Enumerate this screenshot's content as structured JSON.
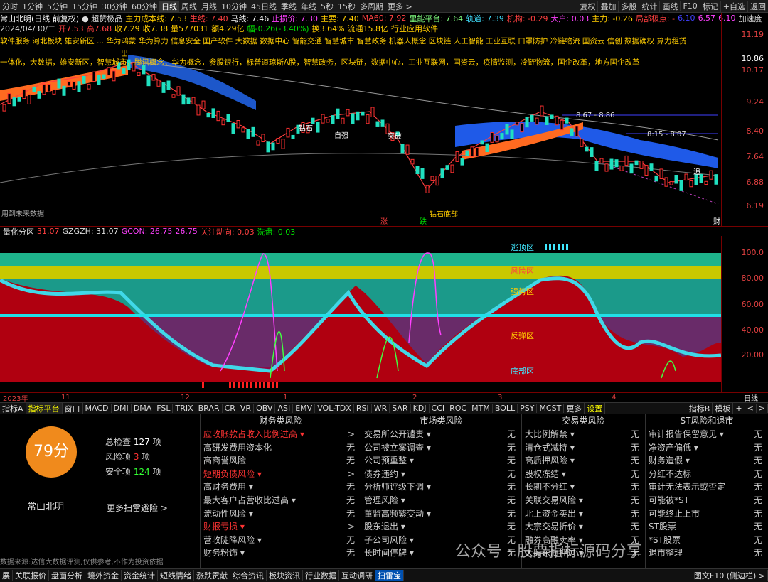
{
  "topbar": {
    "periods": [
      "分时",
      "1分钟",
      "5分钟",
      "15分钟",
      "30分钟",
      "60分钟",
      "日线",
      "周线",
      "月线",
      "10分钟",
      "45日线",
      "季线",
      "年线",
      "5秒",
      "15秒",
      "多周期",
      "更多 >"
    ],
    "selected": "日线",
    "right_buttons": [
      "复权",
      "叠加",
      "多股",
      "统计",
      "画线",
      "F10",
      "标记",
      "+自选",
      "返回"
    ]
  },
  "info": {
    "stock_title": "常山北明(日线 前复权)",
    "indicator": "● 超赞极品",
    "l1": [
      "主力成本线: 7.53",
      "生线: 7.40",
      "马线: 7.46",
      "止损价: 7.30",
      "主要: 7.40",
      "MA60: 7.92",
      "里能平台: 7.64",
      "轨道: 7.39",
      "机构: -0.29",
      "大户: 0.03",
      "主力: -0.26",
      "局部极点: -",
      "6.10",
      "6.57",
      "6.10",
      "加速度"
    ],
    "date": "2024/04/30/二",
    "l2": [
      "开7.53",
      "高7.68",
      "收7.29",
      "收7.38",
      "量577031",
      "额4.29亿",
      "幅-0.26(-3.40%)",
      "换3.64%",
      "流通15.8亿",
      "行业应用软件"
    ],
    "concepts1": "软件服务 河北板块 雄安新区 ... 华为鸿蒙 华为算力 信息安全 国产软件 大数据 数据中心 智能交通 智慧城市 智慧政务 机器人概念 区块链 人工智能 工业互联 口罩防护 冷链物流 国资云 信创 数据确权 算力租赁",
    "concepts2": "一体化，大数据，雄安新区，智慧城市，腾讯概念，华为概念，参股银行，标普道琼斯A股，智慧政务，区块链，数据中心，工业互联网，国资云，疫情监测，冷链物流，国企改革，地方国企改革"
  },
  "yaxis1": [
    "11.19",
    "10.86",
    "10.17",
    "9.24",
    "8.40",
    "7.64",
    "6.88",
    "6.19"
  ],
  "chart_marks": {
    "band1": "8.67 - 8.86",
    "band2": "8:15 - 8.07",
    "labels": [
      "出",
      "出",
      "主",
      "吸",
      "钻石",
      "吸",
      "自强",
      "突破",
      "强",
      "顶",
      "主",
      "底",
      "钻石底部",
      "涨",
      "跌",
      "财",
      "强底",
      "主",
      "卖",
      "亦",
      "追",
      "见"
    ],
    "future_note": "用到未来数据"
  },
  "indicator_head": {
    "name": "量化分区",
    "values": [
      "31.07",
      "GZGZH: 31.07",
      "GCON: 26.75",
      "26.75",
      "关注动向: 0.03",
      "洗盘: 0.03"
    ]
  },
  "zones": [
    "逃顶区",
    "风险区",
    "强势区",
    "反弹区",
    "底部区"
  ],
  "yaxis2": [
    "100.0",
    "80.00",
    "60.00",
    "40.00",
    "20.00"
  ],
  "xaxis": [
    "2023年",
    "11",
    "12",
    "1",
    "2",
    "3",
    "4",
    "日线"
  ],
  "tabs": [
    "指标A",
    "指标平台",
    "窗口",
    "MACD",
    "DMI",
    "DMA",
    "FSL",
    "TRIX",
    "BRAR",
    "CR",
    "VR",
    "OBV",
    "ASI",
    "EMV",
    "VOL-TDX",
    "RSI",
    "WR",
    "SAR",
    "KDJ",
    "CCI",
    "ROC",
    "MTM",
    "BOLL",
    "PSY",
    "MCST",
    "更多",
    "设置"
  ],
  "tabs_right": [
    "指标B",
    "模板",
    "+",
    "<",
    ">"
  ],
  "risk": {
    "score": "79分",
    "name": "常山北明",
    "summary": [
      {
        "label": "总检查",
        "value": "127",
        "unit": "项"
      },
      {
        "label": "风险项",
        "value": "3",
        "unit": "项"
      },
      {
        "label": "安全项",
        "value": "124",
        "unit": "项"
      }
    ],
    "more": "更多扫雷避险 >",
    "footnote": "数据来源:达信大数据评测,仅供参考,不作为投资依据",
    "columns": [
      {
        "title": "财务类风险",
        "items": [
          {
            "n": "应收账款占收入比例过高 ▾",
            "v": ">",
            "hi": true
          },
          {
            "n": "高研发费用资本化",
            "v": "无"
          },
          {
            "n": "高商誉风险",
            "v": "无"
          },
          {
            "n": "短期负债风险 ▾",
            "v": ">",
            "hi": true
          },
          {
            "n": "高财务费用 ▾",
            "v": "无"
          },
          {
            "n": "最大客户占营收比过高 ▾",
            "v": "无"
          },
          {
            "n": "流动性风险 ▾",
            "v": "无"
          },
          {
            "n": "财报亏损 ▾",
            "v": ">",
            "hi": true
          },
          {
            "n": "营收陡降风险 ▾",
            "v": "无"
          },
          {
            "n": "财务粉饰 ▾",
            "v": "无"
          }
        ]
      },
      {
        "title": "市场类风险",
        "items": [
          {
            "n": "交易所公开谴责 ▾",
            "v": "无"
          },
          {
            "n": "公司被立案调查 ▾",
            "v": "无"
          },
          {
            "n": "公司预重整 ▾",
            "v": "无"
          },
          {
            "n": "债券违约 ▾",
            "v": "无"
          },
          {
            "n": "分析师评级下调 ▾",
            "v": "无"
          },
          {
            "n": "管理风险 ▾",
            "v": "无"
          },
          {
            "n": "董监高频繁变动 ▾",
            "v": "无"
          },
          {
            "n": "股东退出 ▾",
            "v": "无"
          },
          {
            "n": "子公司风险 ▾",
            "v": "无"
          },
          {
            "n": "长时间停牌 ▾",
            "v": "无"
          }
        ]
      },
      {
        "title": "交易类风险",
        "items": [
          {
            "n": "大比例解禁 ▾",
            "v": "无"
          },
          {
            "n": "清仓式减持 ▾",
            "v": "无"
          },
          {
            "n": "高质押风险 ▾",
            "v": "无"
          },
          {
            "n": "股权冻结 ▾",
            "v": "无"
          },
          {
            "n": "长期不分红 ▾",
            "v": "无"
          },
          {
            "n": "关联交易风险 ▾",
            "v": "无"
          },
          {
            "n": "北上资金卖出 ▾",
            "v": "无"
          },
          {
            "n": "大宗交易折价 ▾",
            "v": "无"
          },
          {
            "n": "融券高融卖率 ▾",
            "v": "无"
          },
          {
            "n": "大股东质押过 ▾",
            "v": "无"
          }
        ]
      },
      {
        "title": "ST风险和退市",
        "items": [
          {
            "n": "审计报告保留意见 ▾",
            "v": "无"
          },
          {
            "n": "净资产偏低 ▾",
            "v": "无"
          },
          {
            "n": "财务造假 ▾",
            "v": "无"
          },
          {
            "n": "分红不达标",
            "v": "无"
          },
          {
            "n": "审计无法表示或否定",
            "v": "无"
          },
          {
            "n": "可能被*ST",
            "v": "无"
          },
          {
            "n": "可能终止上市",
            "v": "无"
          },
          {
            "n": "ST股票",
            "v": "无"
          },
          {
            "n": "*ST股票",
            "v": "无"
          },
          {
            "n": "退市整理",
            "v": "无"
          }
        ]
      }
    ]
  },
  "bottombar": [
    "展",
    "关联报价",
    "盘面分析",
    "境外资金",
    "资金统计",
    "短线情绪",
    "涨跌贡献",
    "综合资讯",
    "板块资讯",
    "行业数据",
    "互动调研",
    "扫雷宝"
  ],
  "bottombar_right": "图文F10 (侧边栏) >",
  "watermark": "公众号 · 股票指标源码分享",
  "colors": {
    "up": "#e03030",
    "down": "#00e0a0",
    "accent": "#f08a1c"
  }
}
